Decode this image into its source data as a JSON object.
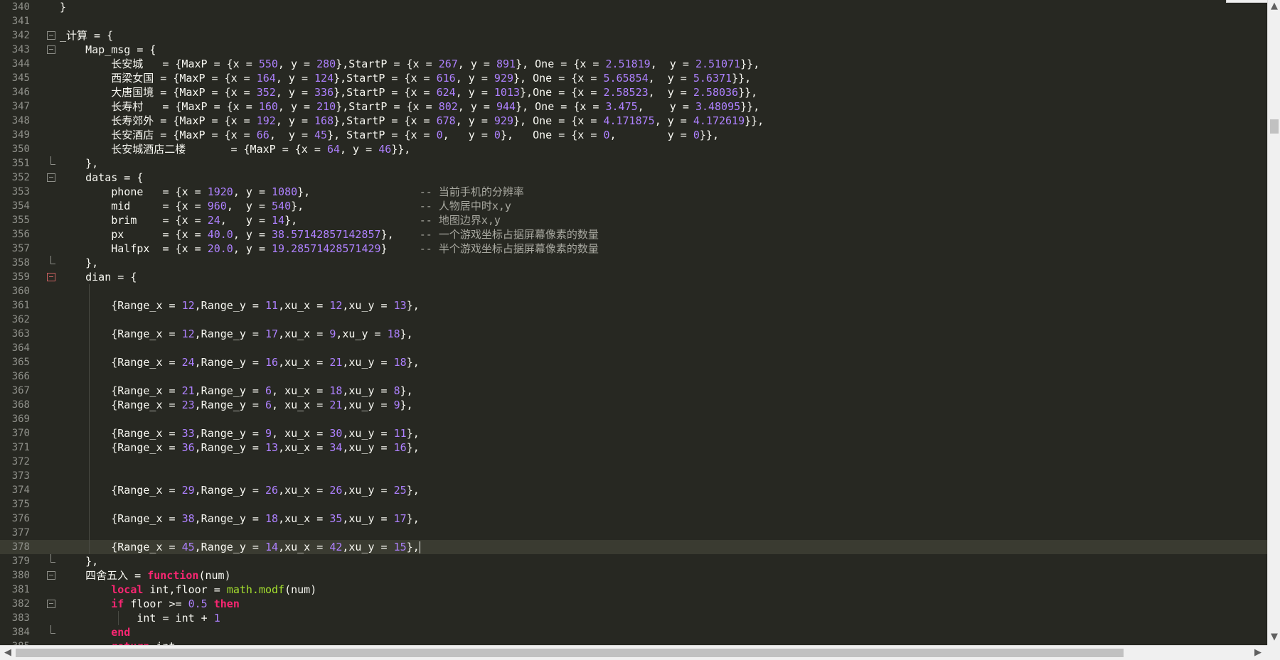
{
  "editor": {
    "current_line": 378,
    "lines": [
      {
        "n": "340",
        "t": [
          [
            "}",
            ""
          ]
        ]
      },
      {
        "n": "341",
        "t": []
      },
      {
        "n": "342",
        "t": [
          [
            "_计算 = {",
            ""
          ]
        ]
      },
      {
        "n": "343",
        "t": [
          [
            "    Map_msg = {",
            ""
          ]
        ]
      },
      {
        "n": "344",
        "t": [
          [
            "        长安城   = {MaxP = {x = ",
            ""
          ],
          [
            "550",
            "p"
          ],
          [
            ", y = ",
            ""
          ],
          [
            "280",
            "p"
          ],
          [
            "},StartP = {x = ",
            ""
          ],
          [
            "267",
            "p"
          ],
          [
            ", y = ",
            ""
          ],
          [
            "891",
            "p"
          ],
          [
            "}, One = {x = ",
            ""
          ],
          [
            "2.51819",
            "p"
          ],
          [
            ",  y = ",
            ""
          ],
          [
            "2.51071",
            "p"
          ],
          [
            "}},",
            ""
          ]
        ]
      },
      {
        "n": "345",
        "t": [
          [
            "        西梁女国 = {MaxP = {x = ",
            ""
          ],
          [
            "164",
            "p"
          ],
          [
            ", y = ",
            ""
          ],
          [
            "124",
            "p"
          ],
          [
            "},StartP = {x = ",
            ""
          ],
          [
            "616",
            "p"
          ],
          [
            ", y = ",
            ""
          ],
          [
            "929",
            "p"
          ],
          [
            "}, One = {x = ",
            ""
          ],
          [
            "5.65854",
            "p"
          ],
          [
            ",  y = ",
            ""
          ],
          [
            "5.6371",
            "p"
          ],
          [
            "}},",
            ""
          ]
        ]
      },
      {
        "n": "346",
        "t": [
          [
            "        大唐国境 = {MaxP = {x = ",
            ""
          ],
          [
            "352",
            "p"
          ],
          [
            ", y = ",
            ""
          ],
          [
            "336",
            "p"
          ],
          [
            "},StartP = {x = ",
            ""
          ],
          [
            "624",
            "p"
          ],
          [
            ", y = ",
            ""
          ],
          [
            "1013",
            "p"
          ],
          [
            "},One = {x = ",
            ""
          ],
          [
            "2.58523",
            "p"
          ],
          [
            ",  y = ",
            ""
          ],
          [
            "2.58036",
            "p"
          ],
          [
            "}},",
            ""
          ]
        ]
      },
      {
        "n": "347",
        "t": [
          [
            "        长寿村   = {MaxP = {x = ",
            ""
          ],
          [
            "160",
            "p"
          ],
          [
            ", y = ",
            ""
          ],
          [
            "210",
            "p"
          ],
          [
            "},StartP = {x = ",
            ""
          ],
          [
            "802",
            "p"
          ],
          [
            ", y = ",
            ""
          ],
          [
            "944",
            "p"
          ],
          [
            "}, One = {x = ",
            ""
          ],
          [
            "3.475",
            "p"
          ],
          [
            ",    y = ",
            ""
          ],
          [
            "3.48095",
            "p"
          ],
          [
            "}},",
            ""
          ]
        ]
      },
      {
        "n": "348",
        "t": [
          [
            "        长寿郊外 = {MaxP = {x = ",
            ""
          ],
          [
            "192",
            "p"
          ],
          [
            ", y = ",
            ""
          ],
          [
            "168",
            "p"
          ],
          [
            "},StartP = {x = ",
            ""
          ],
          [
            "678",
            "p"
          ],
          [
            ", y = ",
            ""
          ],
          [
            "929",
            "p"
          ],
          [
            "}, One = {x = ",
            ""
          ],
          [
            "4.171875",
            "p"
          ],
          [
            ", y = ",
            ""
          ],
          [
            "4.172619",
            "p"
          ],
          [
            "}},",
            ""
          ]
        ]
      },
      {
        "n": "349",
        "t": [
          [
            "        长安酒店 = {MaxP = {x = ",
            ""
          ],
          [
            "66",
            "p"
          ],
          [
            ",  y = ",
            ""
          ],
          [
            "45",
            "p"
          ],
          [
            "}, StartP = {x = ",
            ""
          ],
          [
            "0",
            "p"
          ],
          [
            ",   y = ",
            ""
          ],
          [
            "0",
            "p"
          ],
          [
            "},   One = {x = ",
            ""
          ],
          [
            "0",
            "p"
          ],
          [
            ",        y = ",
            ""
          ],
          [
            "0",
            "p"
          ],
          [
            "}},",
            ""
          ]
        ]
      },
      {
        "n": "350",
        "t": [
          [
            "        长安城酒店二楼       = {MaxP = {x = ",
            ""
          ],
          [
            "64",
            "p"
          ],
          [
            ", y = ",
            ""
          ],
          [
            "46",
            "p"
          ],
          [
            "}},",
            ""
          ]
        ]
      },
      {
        "n": "351",
        "t": [
          [
            "    },",
            ""
          ]
        ]
      },
      {
        "n": "352",
        "t": [
          [
            "    datas = {",
            ""
          ]
        ]
      },
      {
        "n": "353",
        "t": [
          [
            "        phone   = {x = ",
            ""
          ],
          [
            "1920",
            "p"
          ],
          [
            ", y = ",
            ""
          ],
          [
            "1080",
            "p"
          ],
          [
            "},                 ",
            ""
          ],
          [
            "-- 当前手机的分辨率",
            "c"
          ]
        ]
      },
      {
        "n": "354",
        "t": [
          [
            "        mid     = {x = ",
            ""
          ],
          [
            "960",
            "p"
          ],
          [
            ",  y = ",
            ""
          ],
          [
            "540",
            "p"
          ],
          [
            "},                  ",
            ""
          ],
          [
            "-- 人物居中时x,y",
            "c"
          ]
        ]
      },
      {
        "n": "355",
        "t": [
          [
            "        brim    = {x = ",
            ""
          ],
          [
            "24",
            "p"
          ],
          [
            ",   y = ",
            ""
          ],
          [
            "14",
            "p"
          ],
          [
            "},                   ",
            ""
          ],
          [
            "-- 地图边界x,y",
            "c"
          ]
        ]
      },
      {
        "n": "356",
        "t": [
          [
            "        px      = {x = ",
            ""
          ],
          [
            "40.0",
            "p"
          ],
          [
            ", y = ",
            ""
          ],
          [
            "38.57142857142857",
            "p"
          ],
          [
            "},    ",
            ""
          ],
          [
            "-- 一个游戏坐标占据屏幕像素的数量",
            "c"
          ]
        ]
      },
      {
        "n": "357",
        "t": [
          [
            "        Halfpx  = {x = ",
            ""
          ],
          [
            "20.0",
            "p"
          ],
          [
            ", y = ",
            ""
          ],
          [
            "19.28571428571429",
            "p"
          ],
          [
            "}     ",
            ""
          ],
          [
            "-- 半个游戏坐标占据屏幕像素的数量",
            "c"
          ]
        ]
      },
      {
        "n": "358",
        "t": [
          [
            "    },",
            ""
          ]
        ]
      },
      {
        "n": "359",
        "t": [
          [
            "    dian = {",
            ""
          ]
        ]
      },
      {
        "n": "360",
        "t": []
      },
      {
        "n": "361",
        "t": [
          [
            "        {Range_x = ",
            ""
          ],
          [
            "12",
            "p"
          ],
          [
            ",Range_y = ",
            ""
          ],
          [
            "11",
            "p"
          ],
          [
            ",xu_x = ",
            ""
          ],
          [
            "12",
            "p"
          ],
          [
            ",xu_y = ",
            ""
          ],
          [
            "13",
            "p"
          ],
          [
            "},",
            ""
          ]
        ]
      },
      {
        "n": "362",
        "t": []
      },
      {
        "n": "363",
        "t": [
          [
            "        {Range_x = ",
            ""
          ],
          [
            "12",
            "p"
          ],
          [
            ",Range_y = ",
            ""
          ],
          [
            "17",
            "p"
          ],
          [
            ",xu_x = ",
            ""
          ],
          [
            "9",
            "p"
          ],
          [
            ",xu_y = ",
            ""
          ],
          [
            "18",
            "p"
          ],
          [
            "},",
            ""
          ]
        ]
      },
      {
        "n": "364",
        "t": []
      },
      {
        "n": "365",
        "t": [
          [
            "        {Range_x = ",
            ""
          ],
          [
            "24",
            "p"
          ],
          [
            ",Range_y = ",
            ""
          ],
          [
            "16",
            "p"
          ],
          [
            ",xu_x = ",
            ""
          ],
          [
            "21",
            "p"
          ],
          [
            ",xu_y = ",
            ""
          ],
          [
            "18",
            "p"
          ],
          [
            "},",
            ""
          ]
        ]
      },
      {
        "n": "366",
        "t": []
      },
      {
        "n": "367",
        "t": [
          [
            "        {Range_x = ",
            ""
          ],
          [
            "21",
            "p"
          ],
          [
            ",Range_y = ",
            ""
          ],
          [
            "6",
            "p"
          ],
          [
            ", xu_x = ",
            ""
          ],
          [
            "18",
            "p"
          ],
          [
            ",xu_y = ",
            ""
          ],
          [
            "8",
            "p"
          ],
          [
            "},",
            ""
          ]
        ]
      },
      {
        "n": "368",
        "t": [
          [
            "        {Range_x = ",
            ""
          ],
          [
            "23",
            "p"
          ],
          [
            ",Range_y = ",
            ""
          ],
          [
            "6",
            "p"
          ],
          [
            ", xu_x = ",
            ""
          ],
          [
            "21",
            "p"
          ],
          [
            ",xu_y = ",
            ""
          ],
          [
            "9",
            "p"
          ],
          [
            "},",
            ""
          ]
        ]
      },
      {
        "n": "369",
        "t": []
      },
      {
        "n": "370",
        "t": [
          [
            "        {Range_x = ",
            ""
          ],
          [
            "33",
            "p"
          ],
          [
            ",Range_y = ",
            ""
          ],
          [
            "9",
            "p"
          ],
          [
            ", xu_x = ",
            ""
          ],
          [
            "30",
            "p"
          ],
          [
            ",xu_y = ",
            ""
          ],
          [
            "11",
            "p"
          ],
          [
            "},",
            ""
          ]
        ]
      },
      {
        "n": "371",
        "t": [
          [
            "        {Range_x = ",
            ""
          ],
          [
            "36",
            "p"
          ],
          [
            ",Range_y = ",
            ""
          ],
          [
            "13",
            "p"
          ],
          [
            ",xu_x = ",
            ""
          ],
          [
            "34",
            "p"
          ],
          [
            ",xu_y = ",
            ""
          ],
          [
            "16",
            "p"
          ],
          [
            "},",
            ""
          ]
        ]
      },
      {
        "n": "372",
        "t": []
      },
      {
        "n": "373",
        "t": []
      },
      {
        "n": "374",
        "t": [
          [
            "        {Range_x = ",
            ""
          ],
          [
            "29",
            "p"
          ],
          [
            ",Range_y = ",
            ""
          ],
          [
            "26",
            "p"
          ],
          [
            ",xu_x = ",
            ""
          ],
          [
            "26",
            "p"
          ],
          [
            ",xu_y = ",
            ""
          ],
          [
            "25",
            "p"
          ],
          [
            "},",
            ""
          ]
        ]
      },
      {
        "n": "375",
        "t": []
      },
      {
        "n": "376",
        "t": [
          [
            "        {Range_x = ",
            ""
          ],
          [
            "38",
            "p"
          ],
          [
            ",Range_y = ",
            ""
          ],
          [
            "18",
            "p"
          ],
          [
            ",xu_x = ",
            ""
          ],
          [
            "35",
            "p"
          ],
          [
            ",xu_y = ",
            ""
          ],
          [
            "17",
            "p"
          ],
          [
            "},",
            ""
          ]
        ]
      },
      {
        "n": "377",
        "t": []
      },
      {
        "n": "378",
        "t": [
          [
            "        {Range_x = ",
            ""
          ],
          [
            "45",
            "p"
          ],
          [
            ",Range_y = ",
            ""
          ],
          [
            "14",
            "p"
          ],
          [
            ",xu_x = ",
            ""
          ],
          [
            "42",
            "p"
          ],
          [
            ",xu_y = ",
            ""
          ],
          [
            "15",
            "p"
          ],
          [
            "},",
            ""
          ]
        ]
      },
      {
        "n": "379",
        "t": [
          [
            "    },",
            ""
          ]
        ]
      },
      {
        "n": "380",
        "t": [
          [
            "    四舍五入 = ",
            ""
          ],
          [
            "function",
            "kw"
          ],
          [
            "(num)",
            ""
          ]
        ]
      },
      {
        "n": "381",
        "t": [
          [
            "        ",
            ""
          ],
          [
            "local",
            "kw"
          ],
          [
            " int,floor = ",
            ""
          ],
          [
            "math.modf",
            "fn"
          ],
          [
            "(num)",
            ""
          ]
        ]
      },
      {
        "n": "382",
        "t": [
          [
            "        ",
            ""
          ],
          [
            "if",
            "kw"
          ],
          [
            " floor >= ",
            ""
          ],
          [
            "0.5",
            "p"
          ],
          [
            " ",
            ""
          ],
          [
            "then",
            "kw"
          ]
        ]
      },
      {
        "n": "383",
        "t": [
          [
            "            int = int + ",
            ""
          ],
          [
            "1",
            "p"
          ]
        ]
      },
      {
        "n": "384",
        "t": [
          [
            "        ",
            ""
          ],
          [
            "end",
            "kw"
          ]
        ]
      },
      {
        "n": "385",
        "t": [
          [
            "        ",
            ""
          ],
          [
            "return",
            "kw"
          ],
          [
            " int",
            ""
          ]
        ]
      }
    ]
  },
  "scrollbars": {
    "up_arrow": "▲",
    "down_arrow": "▼",
    "left_arrow": "◀",
    "right_arrow": "▶"
  }
}
